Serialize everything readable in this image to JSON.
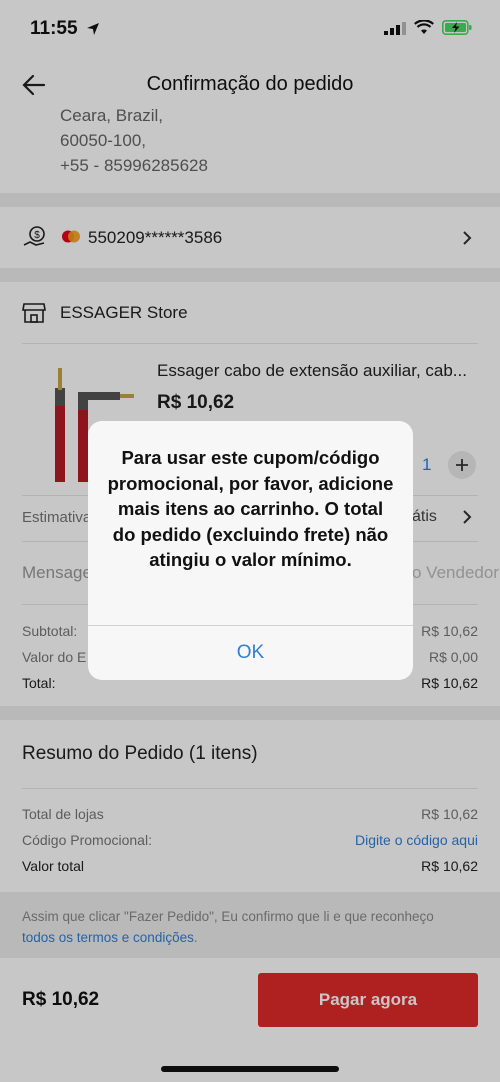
{
  "status_bar": {
    "time": "11:55"
  },
  "header": {
    "title": "Confirmação do pedido"
  },
  "address": {
    "line1": "Ceara, Brazil,",
    "line2": "60050-100,",
    "line3": "+55 - 85996285628"
  },
  "payment": {
    "card_number": "550209******3586"
  },
  "store": {
    "name": "ESSAGER Store"
  },
  "product": {
    "title": "Essager cabo de extensão auxiliar, cab...",
    "price": "R$ 10,62",
    "quantity": "1"
  },
  "shipping": {
    "label": "Estimativa",
    "value_suffix": "átis"
  },
  "message": {
    "label": "Mensage",
    "placeholder_suffix": "o Vendedor"
  },
  "summary_store": {
    "subtotal_label": "Subtotal:",
    "subtotal_value": "R$ 10,62",
    "shipping_label": "Valor do E",
    "shipping_value": "R$ 0,00",
    "total_label": "Total:",
    "total_value": "R$ 10,62"
  },
  "order_summary": {
    "title": "Resumo do Pedido (1 itens)",
    "stores_label": "Total de lojas",
    "stores_value": "R$ 10,62",
    "promo_label": "Código Promocional:",
    "promo_link": "Digite o código aqui",
    "total_label": "Valor total",
    "total_value": "R$ 10,62"
  },
  "terms": {
    "text": "Assim que clicar \"Fazer Pedido\", Eu confirmo que li e que reconheço",
    "link": "todos os termos e condições",
    "end": "."
  },
  "footer": {
    "total": "R$ 10,62",
    "pay_button": "Pagar agora"
  },
  "alert": {
    "message": "Para usar este cupom/código promocional, por favor, adicione mais itens ao carrinho. O total do pedido (excluindo frete) não atingiu o valor mínimo.",
    "ok_button": "OK"
  },
  "colors": {
    "accent_red": "#e02a2a",
    "link_blue": "#2f7fd6"
  }
}
